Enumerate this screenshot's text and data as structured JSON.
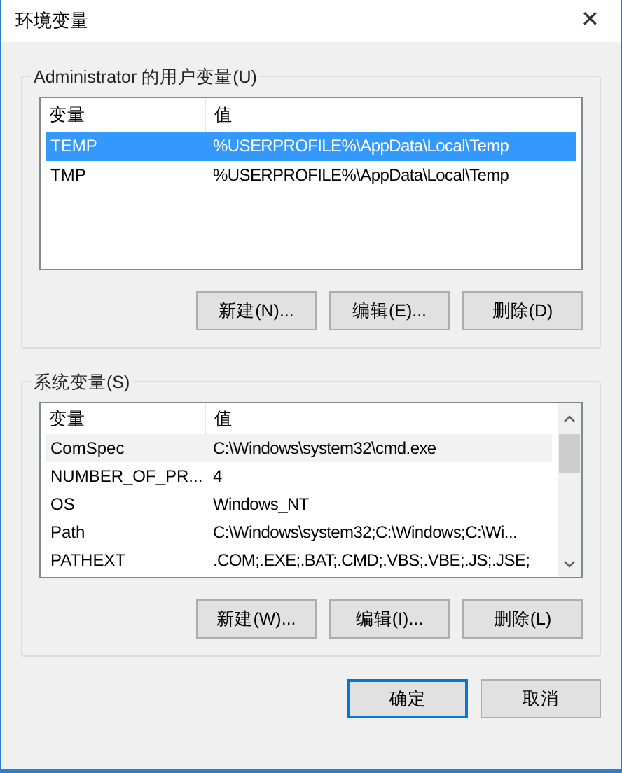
{
  "window": {
    "title": "环境变量",
    "close": "✕"
  },
  "user_vars": {
    "label": "Administrator 的用户变量(U)",
    "columns": [
      "变量",
      "值"
    ],
    "rows": [
      {
        "name": "TEMP",
        "value": "%USERPROFILE%\\AppData\\Local\\Temp",
        "selected": true
      },
      {
        "name": "TMP",
        "value": "%USERPROFILE%\\AppData\\Local\\Temp",
        "selected": false
      }
    ],
    "buttons": [
      "新建(N)...",
      "编辑(E)...",
      "删除(D)"
    ]
  },
  "system_vars": {
    "label": "系统变量(S)",
    "columns": [
      "变量",
      "值"
    ],
    "rows": [
      {
        "name": "ComSpec",
        "value": "C:\\Windows\\system32\\cmd.exe",
        "selected": false
      },
      {
        "name": "NUMBER_OF_PR...",
        "value": "4",
        "selected": false
      },
      {
        "name": "OS",
        "value": "Windows_NT",
        "selected": false
      },
      {
        "name": "Path",
        "value": "C:\\Windows\\system32;C:\\Windows;C:\\Wi...",
        "selected": false
      },
      {
        "name": "PATHEXT",
        "value": ".COM;.EXE;.BAT;.CMD;.VBS;.VBE;.JS;.JSE;",
        "selected": false
      }
    ],
    "buttons": [
      "新建(W)...",
      "编辑(I)...",
      "删除(L)"
    ]
  },
  "buttons": [
    {
      "label": "确定",
      "default": true
    },
    {
      "label": "取消",
      "default": false
    }
  ]
}
